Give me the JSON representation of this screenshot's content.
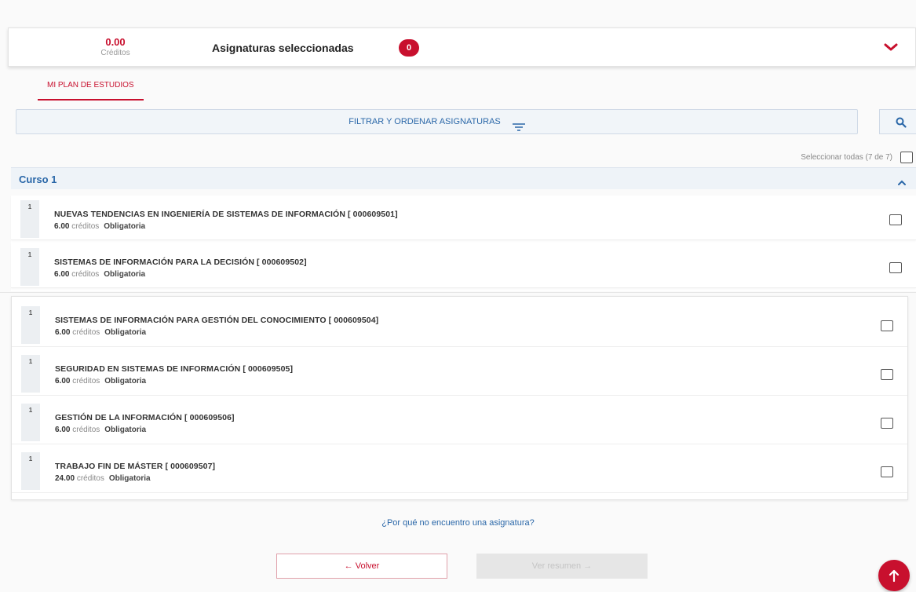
{
  "summary": {
    "credits_value": "0.00",
    "credits_label": "Créditos",
    "title": "Asignaturas seleccionadas",
    "count": "0"
  },
  "tab": {
    "label": "MI PLAN DE ESTUDIOS"
  },
  "filter": {
    "label": "FILTRAR Y ORDENAR ASIGNATURAS"
  },
  "select_all": {
    "label": "Seleccionar todas (7 de 7)"
  },
  "course": {
    "title": "Curso 1"
  },
  "subjects": [
    {
      "num": "1",
      "title": "NUEVAS TENDENCIAS EN INGENIERÍA DE SISTEMAS DE INFORMACIÓN [ 000609501]",
      "credits": "6.00",
      "credits_label": "créditos",
      "type": "Obligatoria"
    },
    {
      "num": "1",
      "title": "SISTEMAS DE INFORMACIÓN PARA LA DECISIÓN [ 000609502]",
      "credits": "6.00",
      "credits_label": "créditos",
      "type": "Obligatoria"
    },
    {
      "num": "1",
      "title": "SISTEMAS DE INFORMACIÓN PARA GESTIÓN DEL CONOCIMIENTO [ 000609504]",
      "credits": "6.00",
      "credits_label": "créditos",
      "type": "Obligatoria"
    },
    {
      "num": "1",
      "title": "SEGURIDAD EN SISTEMAS DE INFORMACIÓN [ 000609505]",
      "credits": "6.00",
      "credits_label": "créditos",
      "type": "Obligatoria"
    },
    {
      "num": "1",
      "title": "GESTIÓN DE LA INFORMACIÓN [ 000609506]",
      "credits": "6.00",
      "credits_label": "créditos",
      "type": "Obligatoria"
    },
    {
      "num": "1",
      "title": "TRABAJO FIN DE MÁSTER [ 000609507]",
      "credits": "24.00",
      "credits_label": "créditos",
      "type": "Obligatoria"
    }
  ],
  "footer": {
    "help_link": "¿Por qué no encuentro una asignatura?",
    "back_label": "Volver",
    "summary_label": "Ver resumen"
  },
  "colors": {
    "accent": "#c8102e",
    "link": "#2a67a8"
  },
  "icons": {
    "collapse": "chevron-down-icon",
    "filter": "filter-lines-icon",
    "search": "search-icon",
    "course_toggle": "chevron-up-icon",
    "back": "arrow-left-icon",
    "forward": "arrow-right-icon",
    "scroll_top": "arrow-up-icon"
  }
}
